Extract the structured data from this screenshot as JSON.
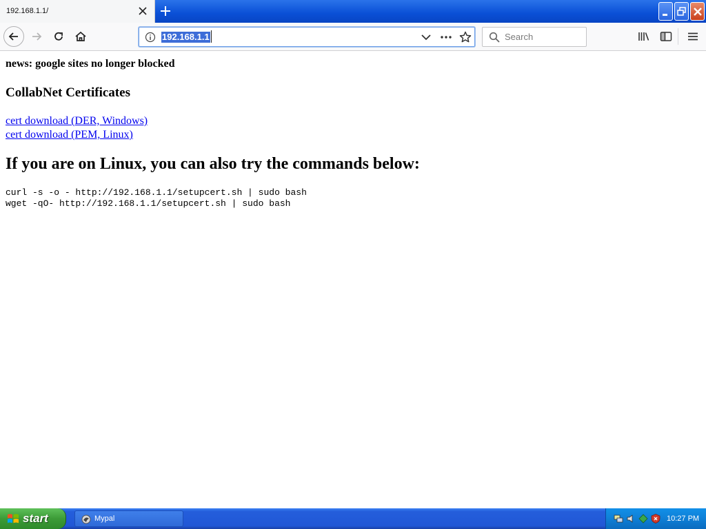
{
  "tab": {
    "title": "192.168.1.1/"
  },
  "urlbar": {
    "value": "192.168.1.1"
  },
  "search": {
    "placeholder": "Search"
  },
  "page": {
    "news": "news: google sites no longer blocked",
    "cert_heading": "CollabNet Certificates",
    "links": [
      {
        "label": "cert download (DER, Windows)"
      },
      {
        "label": "cert download (PEM, Linux)"
      }
    ],
    "linux_heading": "If you are on Linux, you can also try the commands below:",
    "commands": [
      "curl -s -o - http://192.168.1.1/setupcert.sh | sudo bash",
      "wget -qO- http://192.168.1.1/setupcert.sh | sudo bash"
    ]
  },
  "taskbar": {
    "start_label": "start",
    "task_label": "Mypal",
    "clock": "10:27 PM"
  },
  "icons": {
    "tab_close": "close-icon",
    "new_tab": "plus-icon",
    "back": "back-arrow-icon",
    "forward": "forward-arrow-icon",
    "reload": "reload-icon",
    "home": "home-icon",
    "site_info": "info-icon",
    "url_dropdown": "chevron-down-icon",
    "page_actions": "more-dots-icon",
    "bookmark": "star-icon",
    "search": "search-icon",
    "library": "library-icon",
    "sidebar": "sidebar-icon",
    "menu": "hamburger-menu-icon"
  },
  "colors": {
    "link": "#0000ee",
    "selection": "#3d6dd8",
    "titlebar": "#0a4fd6",
    "start_button": "#3c9b37",
    "taskbar": "#245edb"
  }
}
